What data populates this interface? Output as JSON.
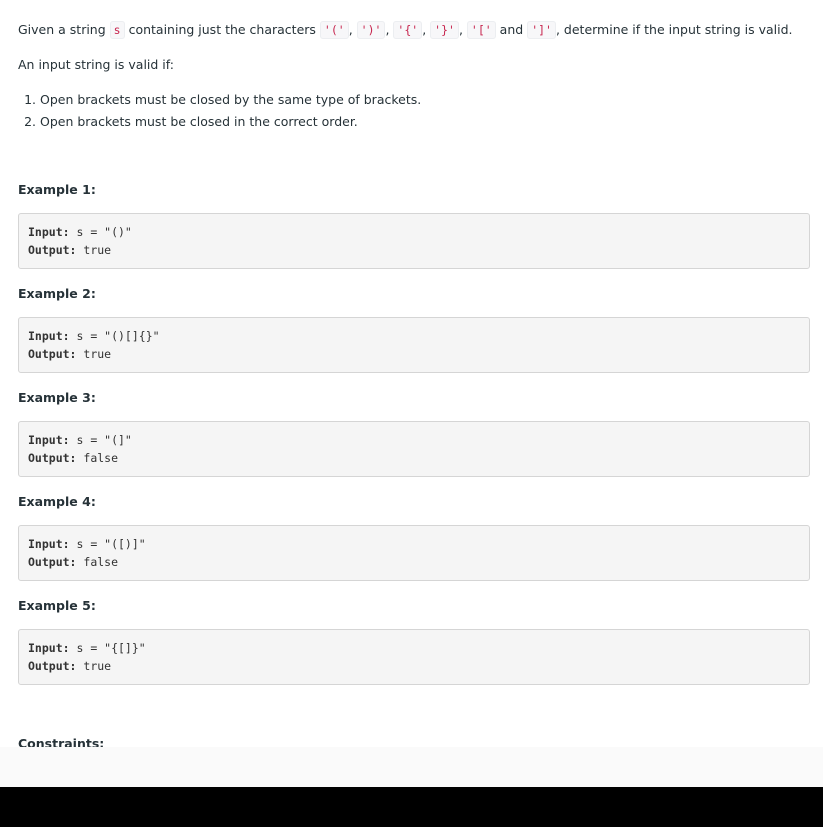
{
  "description": {
    "intro_prefix": "Given a string",
    "intro_var": "s",
    "intro_mid": "containing just the characters",
    "chars": [
      "'('",
      "')'",
      "'{'",
      "'}'",
      "'['",
      "']'"
    ],
    "sep_comma": ",",
    "sep_and": "and",
    "intro_suffix": ", determine if the input string is valid.",
    "valid_if": "An input string is valid if:",
    "rules": [
      "Open brackets must be closed by the same type of brackets.",
      "Open brackets must be closed in the correct order."
    ]
  },
  "examples": [
    {
      "title": "Example 1:",
      "input_label": "Input:",
      "input": " s = \"()\"",
      "output_label": "Output:",
      "output": " true"
    },
    {
      "title": "Example 2:",
      "input_label": "Input:",
      "input": " s = \"()[]{}\"",
      "output_label": "Output:",
      "output": " true"
    },
    {
      "title": "Example 3:",
      "input_label": "Input:",
      "input": " s = \"(]\"",
      "output_label": "Output:",
      "output": " false"
    },
    {
      "title": "Example 4:",
      "input_label": "Input:",
      "input": " s = \"([)]\"",
      "output_label": "Output:",
      "output": " false"
    },
    {
      "title": "Example 5:",
      "input_label": "Input:",
      "input": " s = \"{[]}\"",
      "output_label": "Output:",
      "output": " true"
    }
  ],
  "constraints": {
    "title": "Constraints:"
  },
  "colors": {
    "text": "#263238",
    "inline_code": "#c7254e",
    "code_bg": "#f5f5f5"
  }
}
